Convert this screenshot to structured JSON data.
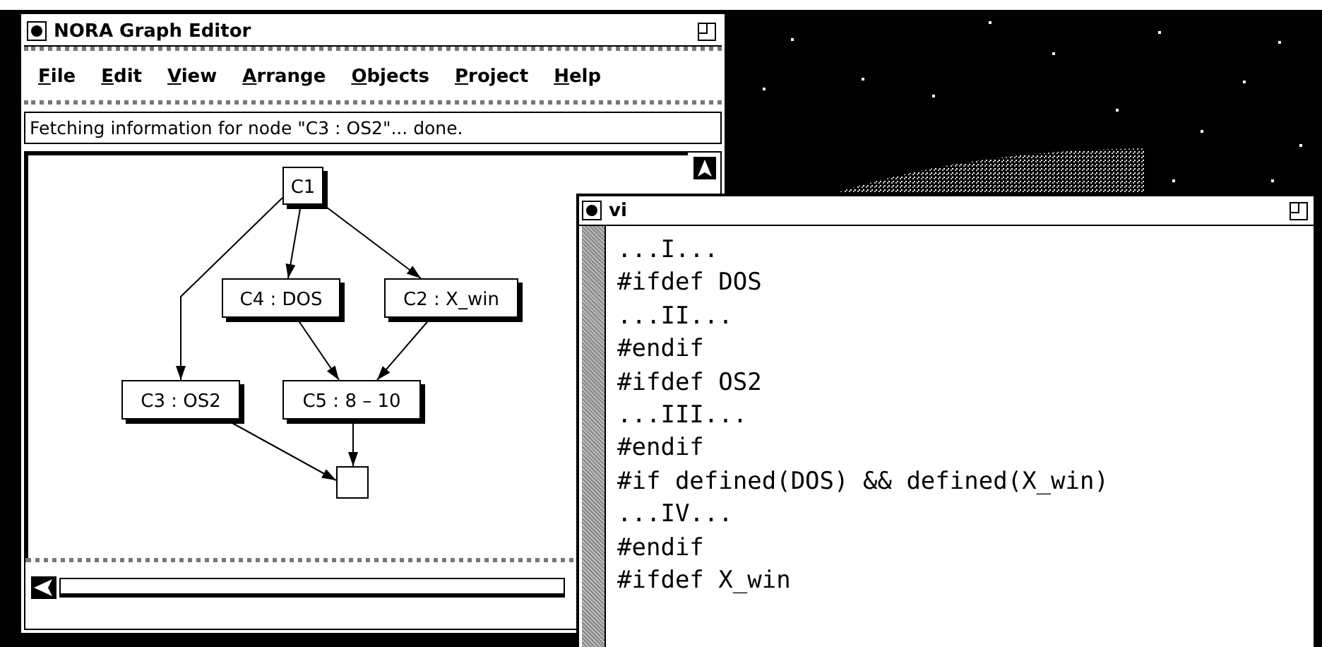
{
  "graph_editor": {
    "title": "NORA Graph Editor",
    "menu": [
      {
        "label": "File"
      },
      {
        "label": "Edit"
      },
      {
        "label": "View"
      },
      {
        "label": "Arrange"
      },
      {
        "label": "Objects"
      },
      {
        "label": "Project"
      },
      {
        "label": "Help"
      }
    ],
    "status": "Fetching information for node \"C3 : OS2\"... done.",
    "nodes": [
      {
        "label": "C1"
      },
      {
        "label": "C4 : DOS"
      },
      {
        "label": "C2 : X_win"
      },
      {
        "label": "C3 : OS2"
      },
      {
        "label": "C5 : 8 – 10"
      }
    ]
  },
  "vi": {
    "title": "vi",
    "lines": [
      "...I...",
      "#ifdef DOS",
      "...II...",
      "#endif",
      "#ifdef OS2",
      "...III...",
      "#endif",
      "#if defined(DOS) && defined(X_win)",
      "...IV...",
      "#endif",
      "#ifdef X_win"
    ]
  }
}
